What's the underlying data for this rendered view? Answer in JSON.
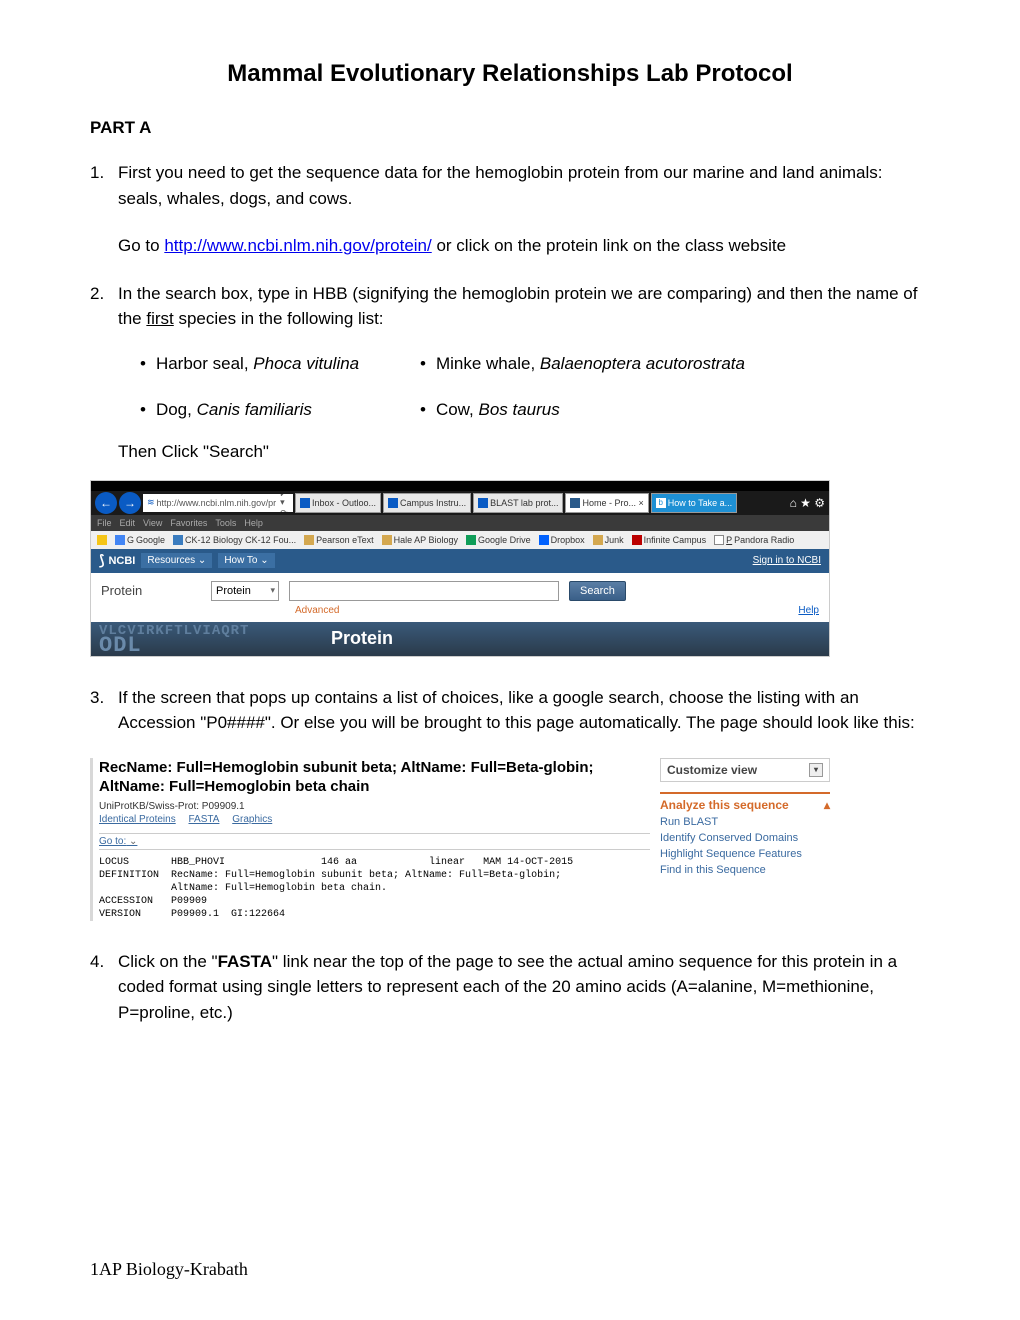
{
  "title": "Mammal Evolutionary Relationships Lab Protocol",
  "section_a": "PART A",
  "items": {
    "i1": {
      "num": "1.",
      "text1": "First you need to get the sequence data for the hemoglobin protein from our marine and land animals: seals, whales, dogs, and cows.",
      "goto_prefix": "Go to ",
      "goto_url": "http://www.ncbi.nlm.nih.gov/protein/",
      "goto_suffix": " or click on the protein link on the class website"
    },
    "i2": {
      "num": "2.",
      "text_a": "In the search box, type in HBB (signifying the hemoglobin protein we are comparing) and then the name of the ",
      "text_first": "first",
      "text_b": " species in the following list:"
    },
    "species": {
      "s1_common": "Harbor seal, ",
      "s1_sci": "Phoca vitulina",
      "s2_common": "Minke whale, ",
      "s2_sci": "Balaenoptera acutorostrata",
      "s3_common": "Dog,  ",
      "s3_sci": "Canis familiaris",
      "s4_common": "Cow,  ",
      "s4_sci": "Bos taurus"
    },
    "then_click": "Then Click \"Search\"",
    "i3": {
      "num": "3.",
      "text": " If the screen that pops up contains a list of choices, like a google search, choose the listing with an Accession \"P0####\". Or else you will be brought to this page automatically. The page should look like this:"
    },
    "i4": {
      "num": "4.",
      "text_a": "Click on the \"",
      "text_fasta": "FASTA",
      "text_b": "\" link near the top of the page to see the actual amino sequence for this protein in a coded format using single letters to represent each of the 20 amino acids (A=alanine, M=methionine, P=proline, etc.)"
    }
  },
  "browser": {
    "addr": "http://www.ncbi.nlm.nih.gov/pr",
    "search_glyph": "🔎 ▾ ⟳",
    "tabs": {
      "inbox": "Inbox - Outloo...",
      "campus": "Campus Instru...",
      "blast": "BLAST lab prot...",
      "home": "Home - Pro...  ×",
      "howto": "How to Take a..."
    },
    "stars": "⌂ ★ ⚙",
    "menus": [
      "File",
      "Edit",
      "View",
      "Favorites",
      "Tools",
      "Help"
    ],
    "favs": {
      "g": "Google",
      "ck": "CK-12 Biology CK-12 Fou...",
      "pearson": "Pearson eText",
      "hale": "Hale AP Biology",
      "gd": "Google Drive",
      "db": "Dropbox",
      "junk": "Junk",
      "ic": "Infinite Campus",
      "pandora": "Pandora Radio"
    },
    "ncbi": "NCBI",
    "resources": "Resources ⌄",
    "howto_pill": "How To ⌄",
    "signin": "Sign in to NCBI",
    "protein_label": "Protein",
    "select_val": "Protein",
    "search_btn": "Search",
    "advanced": "Advanced",
    "help": "Help",
    "seq_bg": "VLCVIRKFTLVIAQRT",
    "seq_bg2": "ODL",
    "protein_word": "Protein"
  },
  "result": {
    "title": "RecName: Full=Hemoglobin subunit beta; AltName: Full=Beta-globin; AltName: Full=Hemoglobin beta chain",
    "sub": "UniProtKB/Swiss-Prot: P09909.1",
    "links": {
      "ip": "Identical Proteins",
      "fasta": "FASTA",
      "graphics": "Graphics"
    },
    "goto": "Go to:",
    "mono": "LOCUS       HBB_PHOVI                146 aa            linear   MAM 14-OCT-2015\nDEFINITION  RecName: Full=Hemoglobin subunit beta; AltName: Full=Beta-globin;\n            AltName: Full=Hemoglobin beta chain.\nACCESSION   P09909\nVERSION     P09909.1  GI:122664",
    "right": {
      "custom": "Customize view",
      "analyze": "Analyze this sequence",
      "run": "Run BLAST",
      "icd": "Identify Conserved Domains",
      "hsf": "Highlight Sequence Features",
      "fis": "Find in this Sequence"
    }
  },
  "footer": "1AP Biology-Krabath"
}
